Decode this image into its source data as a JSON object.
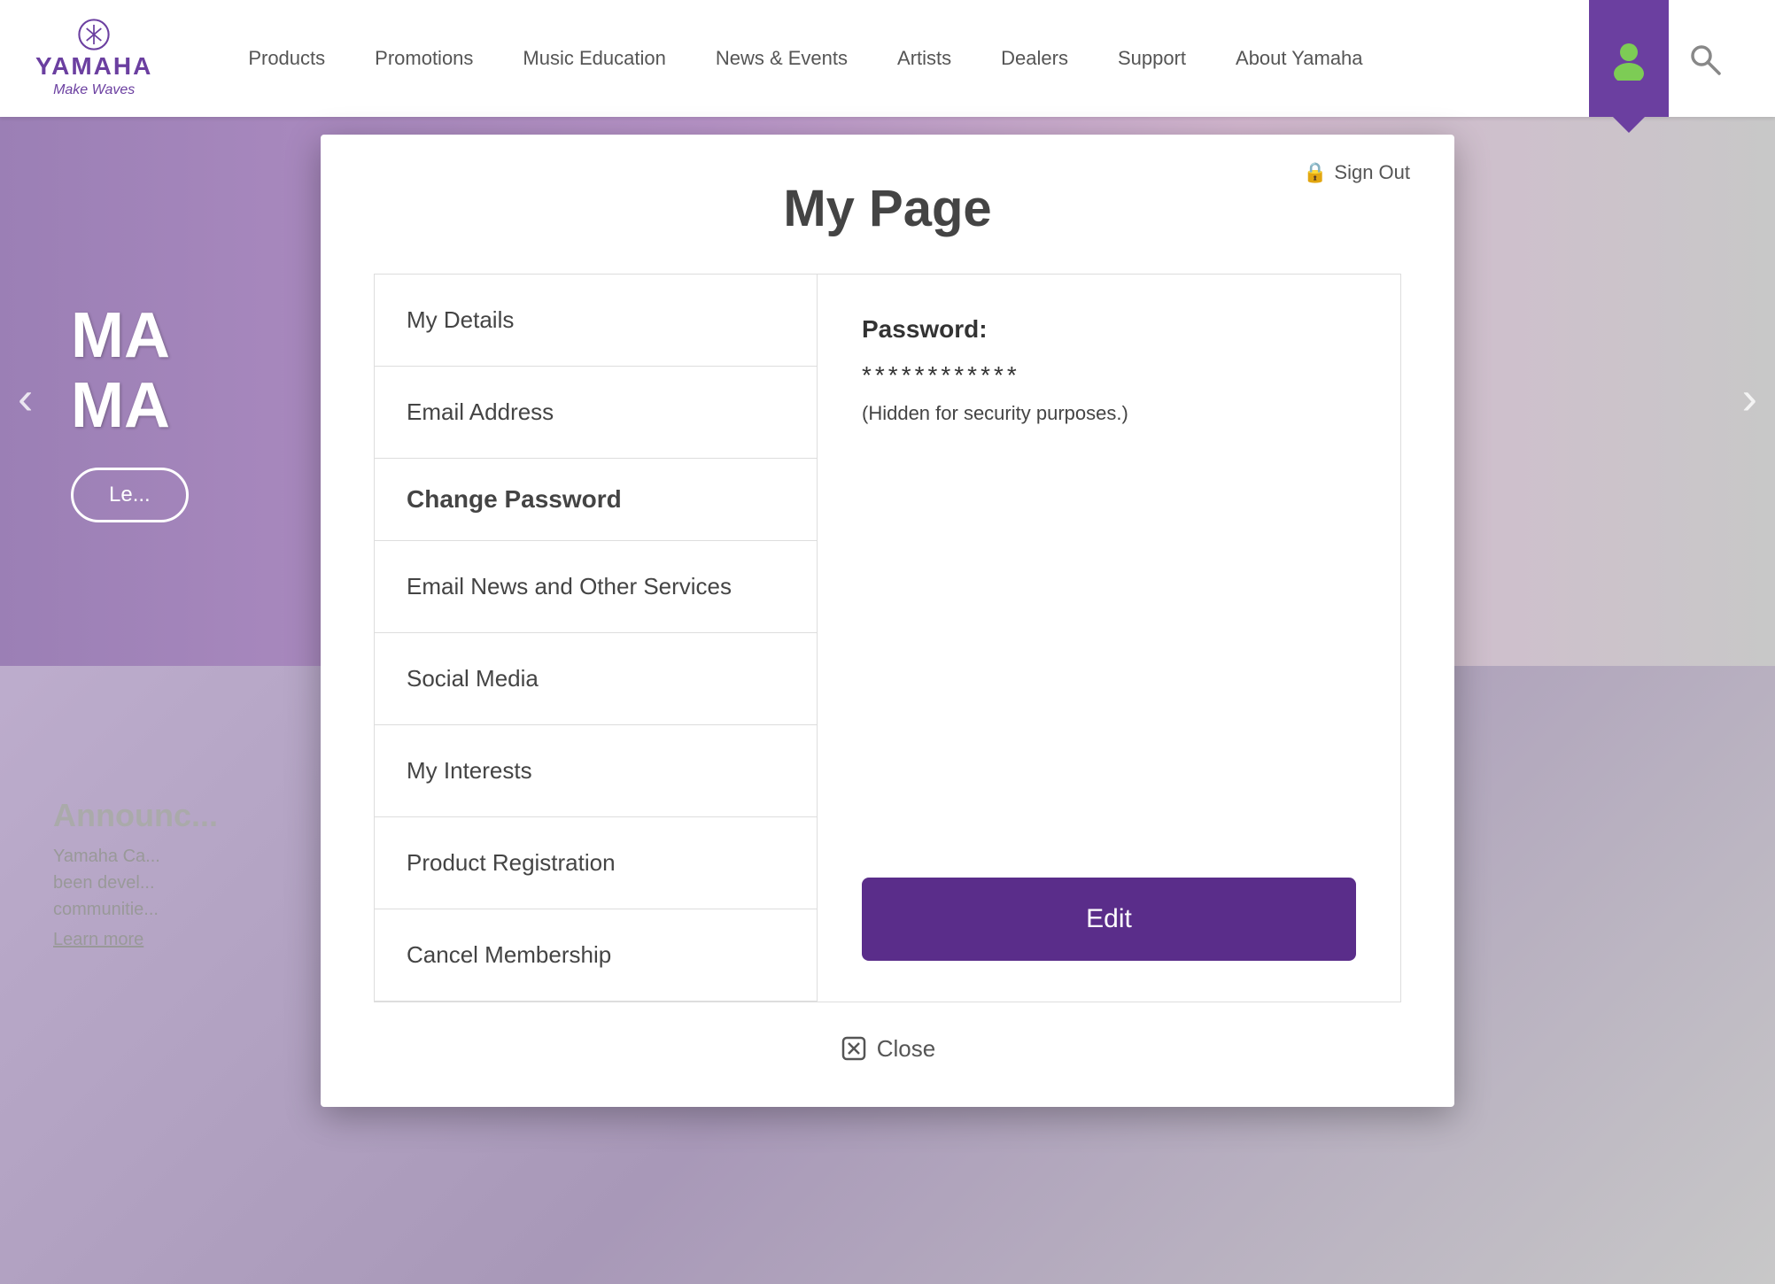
{
  "header": {
    "logo_text": "YAMAHA",
    "logo_tagline": "Make Waves",
    "nav_items": [
      {
        "label": "Products",
        "id": "products"
      },
      {
        "label": "Promotions",
        "id": "promotions"
      },
      {
        "label": "Music Education",
        "id": "music-education"
      },
      {
        "label": "News & Events",
        "id": "news-events"
      },
      {
        "label": "Artists",
        "id": "artists"
      },
      {
        "label": "Dealers",
        "id": "dealers"
      },
      {
        "label": "Support",
        "id": "support"
      },
      {
        "label": "About Yamaha",
        "id": "about"
      }
    ]
  },
  "hero": {
    "headline_line1": "MA",
    "headline_line2": "MA",
    "button_label": "Le..."
  },
  "news": {
    "title": "Announc...",
    "body_line1": "Yamaha Ca...",
    "body_line2": "been devel...",
    "body_line3": "communitie...",
    "link": "Learn more"
  },
  "modal": {
    "title": "My Page",
    "sign_out_label": "Sign Out",
    "sidebar_items": [
      {
        "label": "My Details",
        "id": "my-details"
      },
      {
        "label": "Email Address",
        "id": "email-address"
      },
      {
        "label": "Change Password",
        "id": "change-password",
        "bold": true
      },
      {
        "label": "Email News and Other Services",
        "id": "email-news"
      },
      {
        "label": "Social Media",
        "id": "social-media"
      },
      {
        "label": "My Interests",
        "id": "my-interests"
      },
      {
        "label": "Product Registration",
        "id": "product-registration"
      },
      {
        "label": "Cancel Membership",
        "id": "cancel-membership"
      }
    ],
    "content": {
      "password_label": "Password:",
      "password_dots": "************",
      "password_hint": "(Hidden for security purposes.)"
    },
    "edit_button_label": "Edit",
    "close_label": "Close"
  },
  "colors": {
    "brand_purple": "#6b3fa0",
    "dark_purple": "#5a2d8a"
  }
}
